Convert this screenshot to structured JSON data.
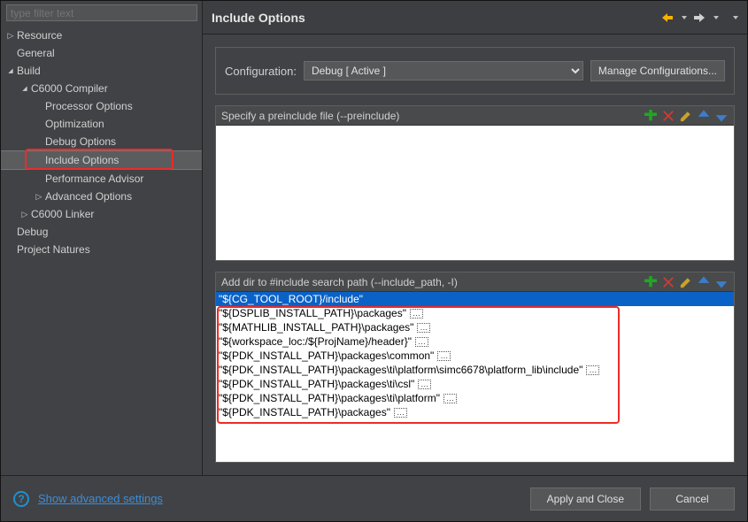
{
  "sidebar": {
    "filter_placeholder": "type filter text",
    "items": [
      {
        "label": "Resource",
        "depth": 0,
        "arrow": "right"
      },
      {
        "label": "General",
        "depth": 0,
        "arrow": ""
      },
      {
        "label": "Build",
        "depth": 0,
        "arrow": "down"
      },
      {
        "label": "C6000 Compiler",
        "depth": 1,
        "arrow": "down"
      },
      {
        "label": "Processor Options",
        "depth": 2,
        "arrow": ""
      },
      {
        "label": "Optimization",
        "depth": 2,
        "arrow": ""
      },
      {
        "label": "Debug Options",
        "depth": 2,
        "arrow": ""
      },
      {
        "label": "Include Options",
        "depth": 2,
        "arrow": "",
        "selected": true
      },
      {
        "label": "Performance Advisor",
        "depth": 2,
        "arrow": ""
      },
      {
        "label": "Advanced Options",
        "depth": 2,
        "arrow": "right"
      },
      {
        "label": "C6000 Linker",
        "depth": 1,
        "arrow": "right"
      },
      {
        "label": "Debug",
        "depth": 0,
        "arrow": ""
      },
      {
        "label": "Project Natures",
        "depth": 0,
        "arrow": ""
      }
    ]
  },
  "header": {
    "title": "Include Options"
  },
  "config": {
    "label": "Configuration:",
    "value": "Debug  [ Active ]",
    "manage_label": "Manage Configurations..."
  },
  "preinclude": {
    "label": "Specify a preinclude file (--preinclude)"
  },
  "include_path": {
    "label": "Add dir to #include search path (--include_path, -I)",
    "rows": [
      {
        "text": "\"${CG_TOOL_ROOT}/include\"",
        "selected": true,
        "dots": false
      },
      {
        "text": "\"${DSPLIB_INSTALL_PATH}\\packages\"",
        "dots": true
      },
      {
        "text": "\"${MATHLIB_INSTALL_PATH}\\packages\"",
        "dots": true
      },
      {
        "text": "\"${workspace_loc:/${ProjName}/header}\"",
        "dots": true
      },
      {
        "text": "\"${PDK_INSTALL_PATH}\\packages\\common\"",
        "dots": true
      },
      {
        "text": "\"${PDK_INSTALL_PATH}\\packages\\ti\\platform\\simc6678\\platform_lib\\include\"",
        "dots": true
      },
      {
        "text": "\"${PDK_INSTALL_PATH}\\packages\\ti\\csl\"",
        "dots": true
      },
      {
        "text": "\"${PDK_INSTALL_PATH}\\packages\\ti\\platform\"",
        "dots": true
      },
      {
        "text": "\"${PDK_INSTALL_PATH}\\packages\"",
        "dots": true
      }
    ]
  },
  "footer": {
    "advanced_label": "Show advanced settings",
    "apply_label": "Apply and Close",
    "cancel_label": "Cancel"
  }
}
